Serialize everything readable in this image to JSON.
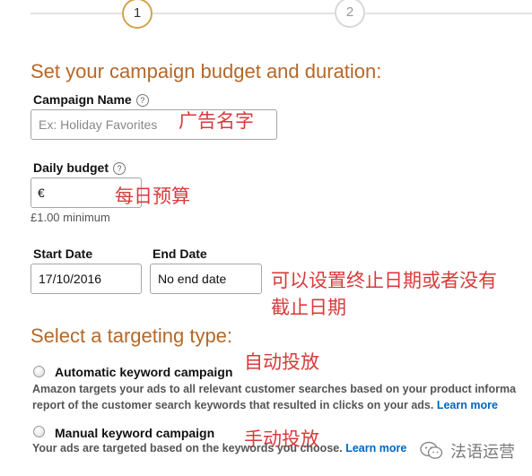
{
  "stepper": {
    "step1": "1",
    "step2": "2",
    "active_step": 1
  },
  "page": {
    "title": "Set your campaign budget and duration:"
  },
  "campaign_name": {
    "label": "Campaign Name",
    "help": "?",
    "placeholder": "Ex: Holiday Favorites",
    "annotation": "广告名字"
  },
  "daily_budget": {
    "label": "Daily budget",
    "help": "?",
    "value": "€",
    "hint": "£1.00 minimum",
    "annotation": "每日预算"
  },
  "dates": {
    "start_label": "Start Date",
    "start_value": "17/10/2016",
    "end_label": "End Date",
    "end_value": "No end date",
    "annotation_line1": "可以设置终止日期或者没有",
    "annotation_line2": "截止日期"
  },
  "targeting": {
    "title": "Select a targeting type:",
    "automatic": {
      "label": "Automatic keyword campaign",
      "annotation": "自动投放",
      "desc_line1": "Amazon targets your ads to all relevant customer searches based on your product informa",
      "desc_line2": "report of the customer search keywords that resulted in clicks on your ads.",
      "learn_more": "Learn more"
    },
    "manual": {
      "label": "Manual keyword campaign",
      "annotation": "手动投放",
      "desc": "Your ads are targeted based on the keywords you choose.",
      "learn_more": "Learn more"
    }
  },
  "watermark": {
    "text": "法语运营",
    "icon": "wechat-icon"
  },
  "colors": {
    "heading": "#b4682b",
    "annotation": "#d93a3a",
    "link": "#0066c0",
    "step_active": "#d4a24a"
  }
}
